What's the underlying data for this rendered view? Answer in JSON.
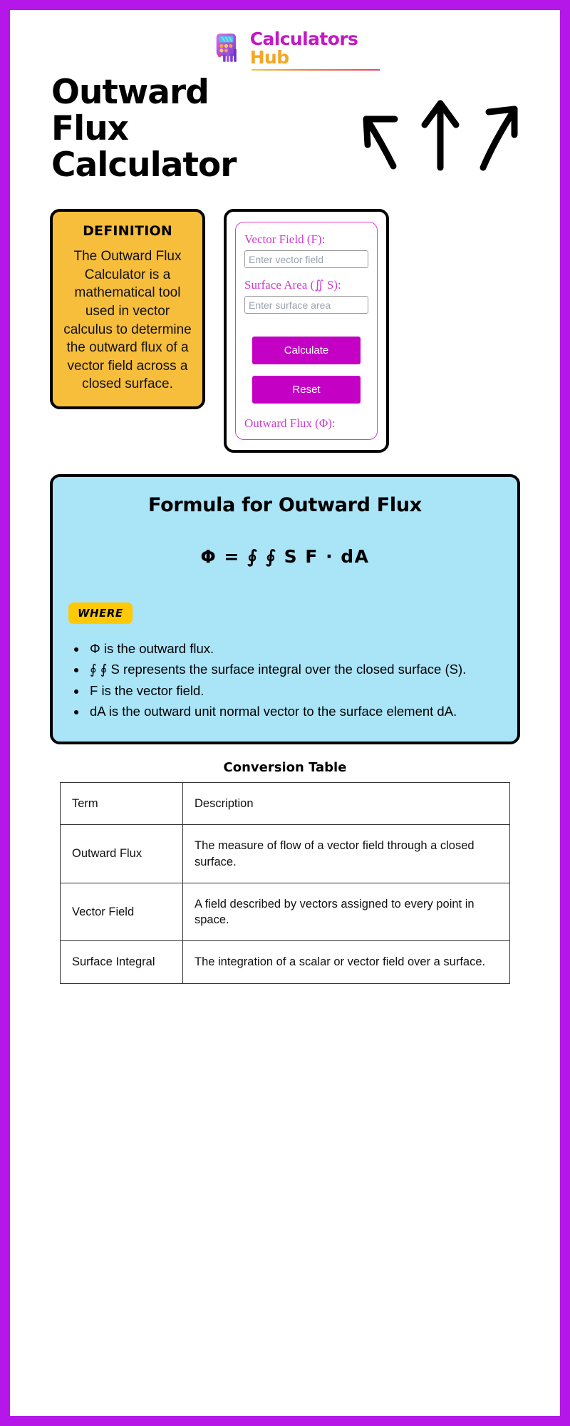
{
  "brand": {
    "name_line1": "Calculators",
    "name_line2": "Hub",
    "logo_icon": "calculator-bar-chart-icon"
  },
  "hero": {
    "title": "Outward Flux Calculator",
    "arrows_icon": "three-hand-drawn-arrows"
  },
  "definition": {
    "heading": "DEFINITION",
    "body": "The Outward Flux Calculator is a mathematical tool used in vector calculus to determine the outward flux of a vector field across a closed surface."
  },
  "calculator": {
    "vector_field_label": "Vector Field (F):",
    "vector_field_placeholder": "Enter vector field",
    "vector_field_value": "",
    "surface_area_label": "Surface Area (∬ S):",
    "surface_area_placeholder": "Enter surface area",
    "surface_area_value": "",
    "calculate_label": "Calculate",
    "reset_label": "Reset",
    "result_label": "Outward Flux (Φ):",
    "accent_color": "#C400C4",
    "label_color": "#CF3BD1"
  },
  "formula": {
    "title": "Formula for Outward Flux",
    "equation": "Φ =  ∮ ∮ S F ·  dA",
    "where_badge": "WHERE",
    "items": [
      "Φ is the outward flux.",
      "∮ ∮ S represents the surface integral over the closed surface (S).",
      "F is the vector field.",
      "dA is the outward unit normal vector to the surface element dA."
    ],
    "background_color": "#A9E4F7"
  },
  "conversion_table": {
    "title": "Conversion Table",
    "headers": [
      "Term",
      "Description"
    ],
    "rows": [
      [
        "Outward Flux",
        "The measure of flow of a vector field through a closed surface."
      ],
      [
        "Vector Field",
        "A field described by vectors assigned to every point in space."
      ],
      [
        "Surface Integral",
        "The integration of a scalar or vector field over a surface."
      ]
    ]
  }
}
